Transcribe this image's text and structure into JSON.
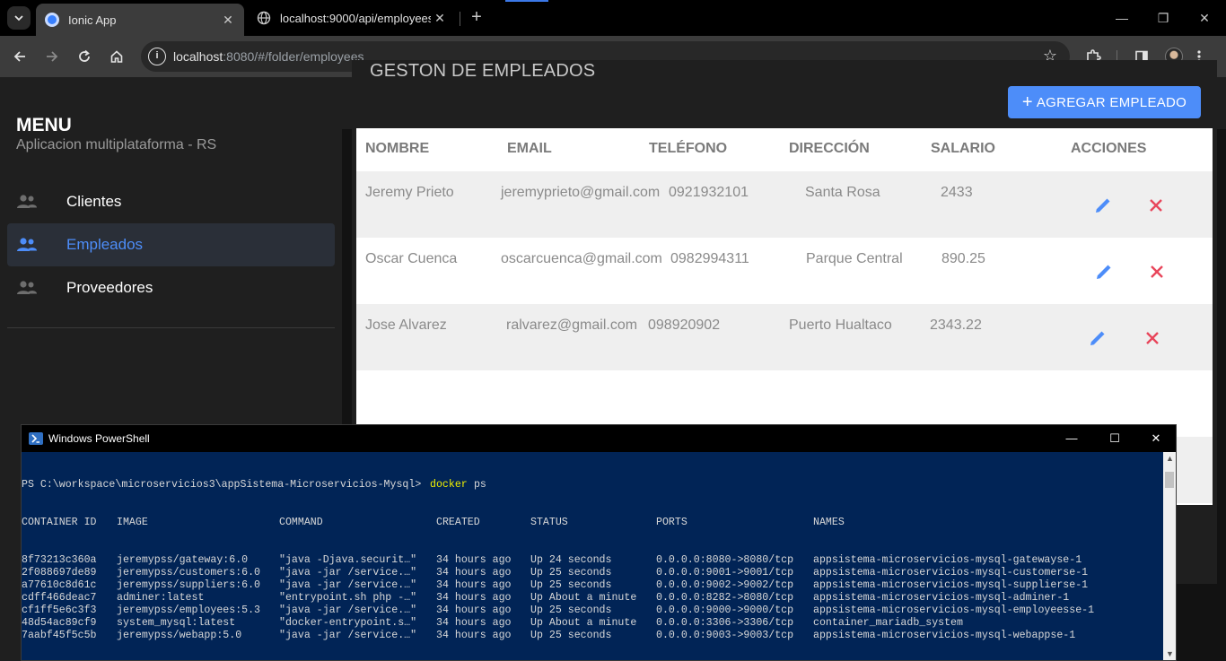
{
  "browser": {
    "tabs": [
      {
        "title": "Ionic App",
        "active": true
      },
      {
        "title": "localhost:9000/api/employees",
        "active": false
      }
    ],
    "url_host": "localhost",
    "url_rest": ":8080/#/folder/employees",
    "window_controls": {
      "minimize": "—",
      "restore": "❐",
      "close": "✕"
    }
  },
  "menu": {
    "title": "MENU",
    "subtitle": "Aplicacion multiplataforma - RS",
    "items": [
      {
        "label": "Clientes",
        "icon": "people-icon",
        "active": false
      },
      {
        "label": "Empleados",
        "icon": "people-icon",
        "active": true
      },
      {
        "label": "Proveedores",
        "icon": "people-icon",
        "active": false
      }
    ]
  },
  "page": {
    "title": "GESTON DE EMPLEADOS",
    "add_button": "AGREGAR EMPLEADO",
    "columns": [
      "NOMBRE",
      "EMAIL",
      "TELÉFONO",
      "DIRECCIÓN",
      "SALARIO",
      "ACCIONES"
    ],
    "rows": [
      {
        "nombre": "Jeremy Prieto",
        "email": "jeremyprieto@gmail.com",
        "telefono": "0921932101",
        "direccion": "Santa Rosa",
        "salario": "2433"
      },
      {
        "nombre": "Oscar Cuenca",
        "email": "oscarcuenca@gmail.com",
        "telefono": "0982994311",
        "direccion": "Parque Central",
        "salario": "890.25"
      },
      {
        "nombre": "Jose Alvarez",
        "email": "ralvarez@gmail.com",
        "telefono": "098920902",
        "direccion": "Puerto Hualtaco",
        "salario": "2343.22"
      }
    ],
    "colors": {
      "accent": "#4d8df9",
      "delete": "#e8455a"
    }
  },
  "powershell": {
    "title": "Windows PowerShell",
    "prompt": "PS C:\\workspace\\microservicios3\\appSistema-Microservicios-Mysql>",
    "command": "docker",
    "command_arg": " ps",
    "headers": [
      "CONTAINER ID",
      "IMAGE",
      "COMMAND",
      "CREATED",
      "STATUS",
      "PORTS",
      "NAMES"
    ],
    "containers": [
      [
        "8f73213c360a",
        "jeremypss/gateway:6.0",
        "\"java -Djava.securit…\"",
        "34 hours ago",
        "Up 24 seconds",
        "0.0.0.0:8080->8080/tcp",
        "appsistema-microservicios-mysql-gatewayse-1"
      ],
      [
        "2f088697de89",
        "jeremypss/customers:6.0",
        "\"java -jar /service.…\"",
        "34 hours ago",
        "Up 25 seconds",
        "0.0.0.0:9001->9001/tcp",
        "appsistema-microservicios-mysql-customerse-1"
      ],
      [
        "a77610c8d61c",
        "jeremypss/suppliers:6.0",
        "\"java -jar /service.…\"",
        "34 hours ago",
        "Up 25 seconds",
        "0.0.0.0:9002->9002/tcp",
        "appsistema-microservicios-mysql-supplierse-1"
      ],
      [
        "cdff466deac7",
        "adminer:latest",
        "\"entrypoint.sh php -…\"",
        "34 hours ago",
        "Up About a minute",
        "0.0.0.0:8282->8080/tcp",
        "appsistema-microservicios-mysql-adminer-1"
      ],
      [
        "cf1ff5e6c3f3",
        "jeremypss/employees:5.3",
        "\"java -jar /service.…\"",
        "34 hours ago",
        "Up 25 seconds",
        "0.0.0.0:9000->9000/tcp",
        "appsistema-microservicios-mysql-employeesse-1"
      ],
      [
        "48d54ac89cf9",
        "system_mysql:latest",
        "\"docker-entrypoint.s…\"",
        "34 hours ago",
        "Up About a minute",
        "0.0.0.0:3306->3306/tcp",
        "container_mariadb_system"
      ],
      [
        "7aabf45f5c5b",
        "jeremypss/webapp:5.0",
        "\"java -jar /service.…\"",
        "34 hours ago",
        "Up 25 seconds",
        "0.0.0.0:9003->9003/tcp",
        "appsistema-microservicios-mysql-webappse-1"
      ]
    ]
  }
}
